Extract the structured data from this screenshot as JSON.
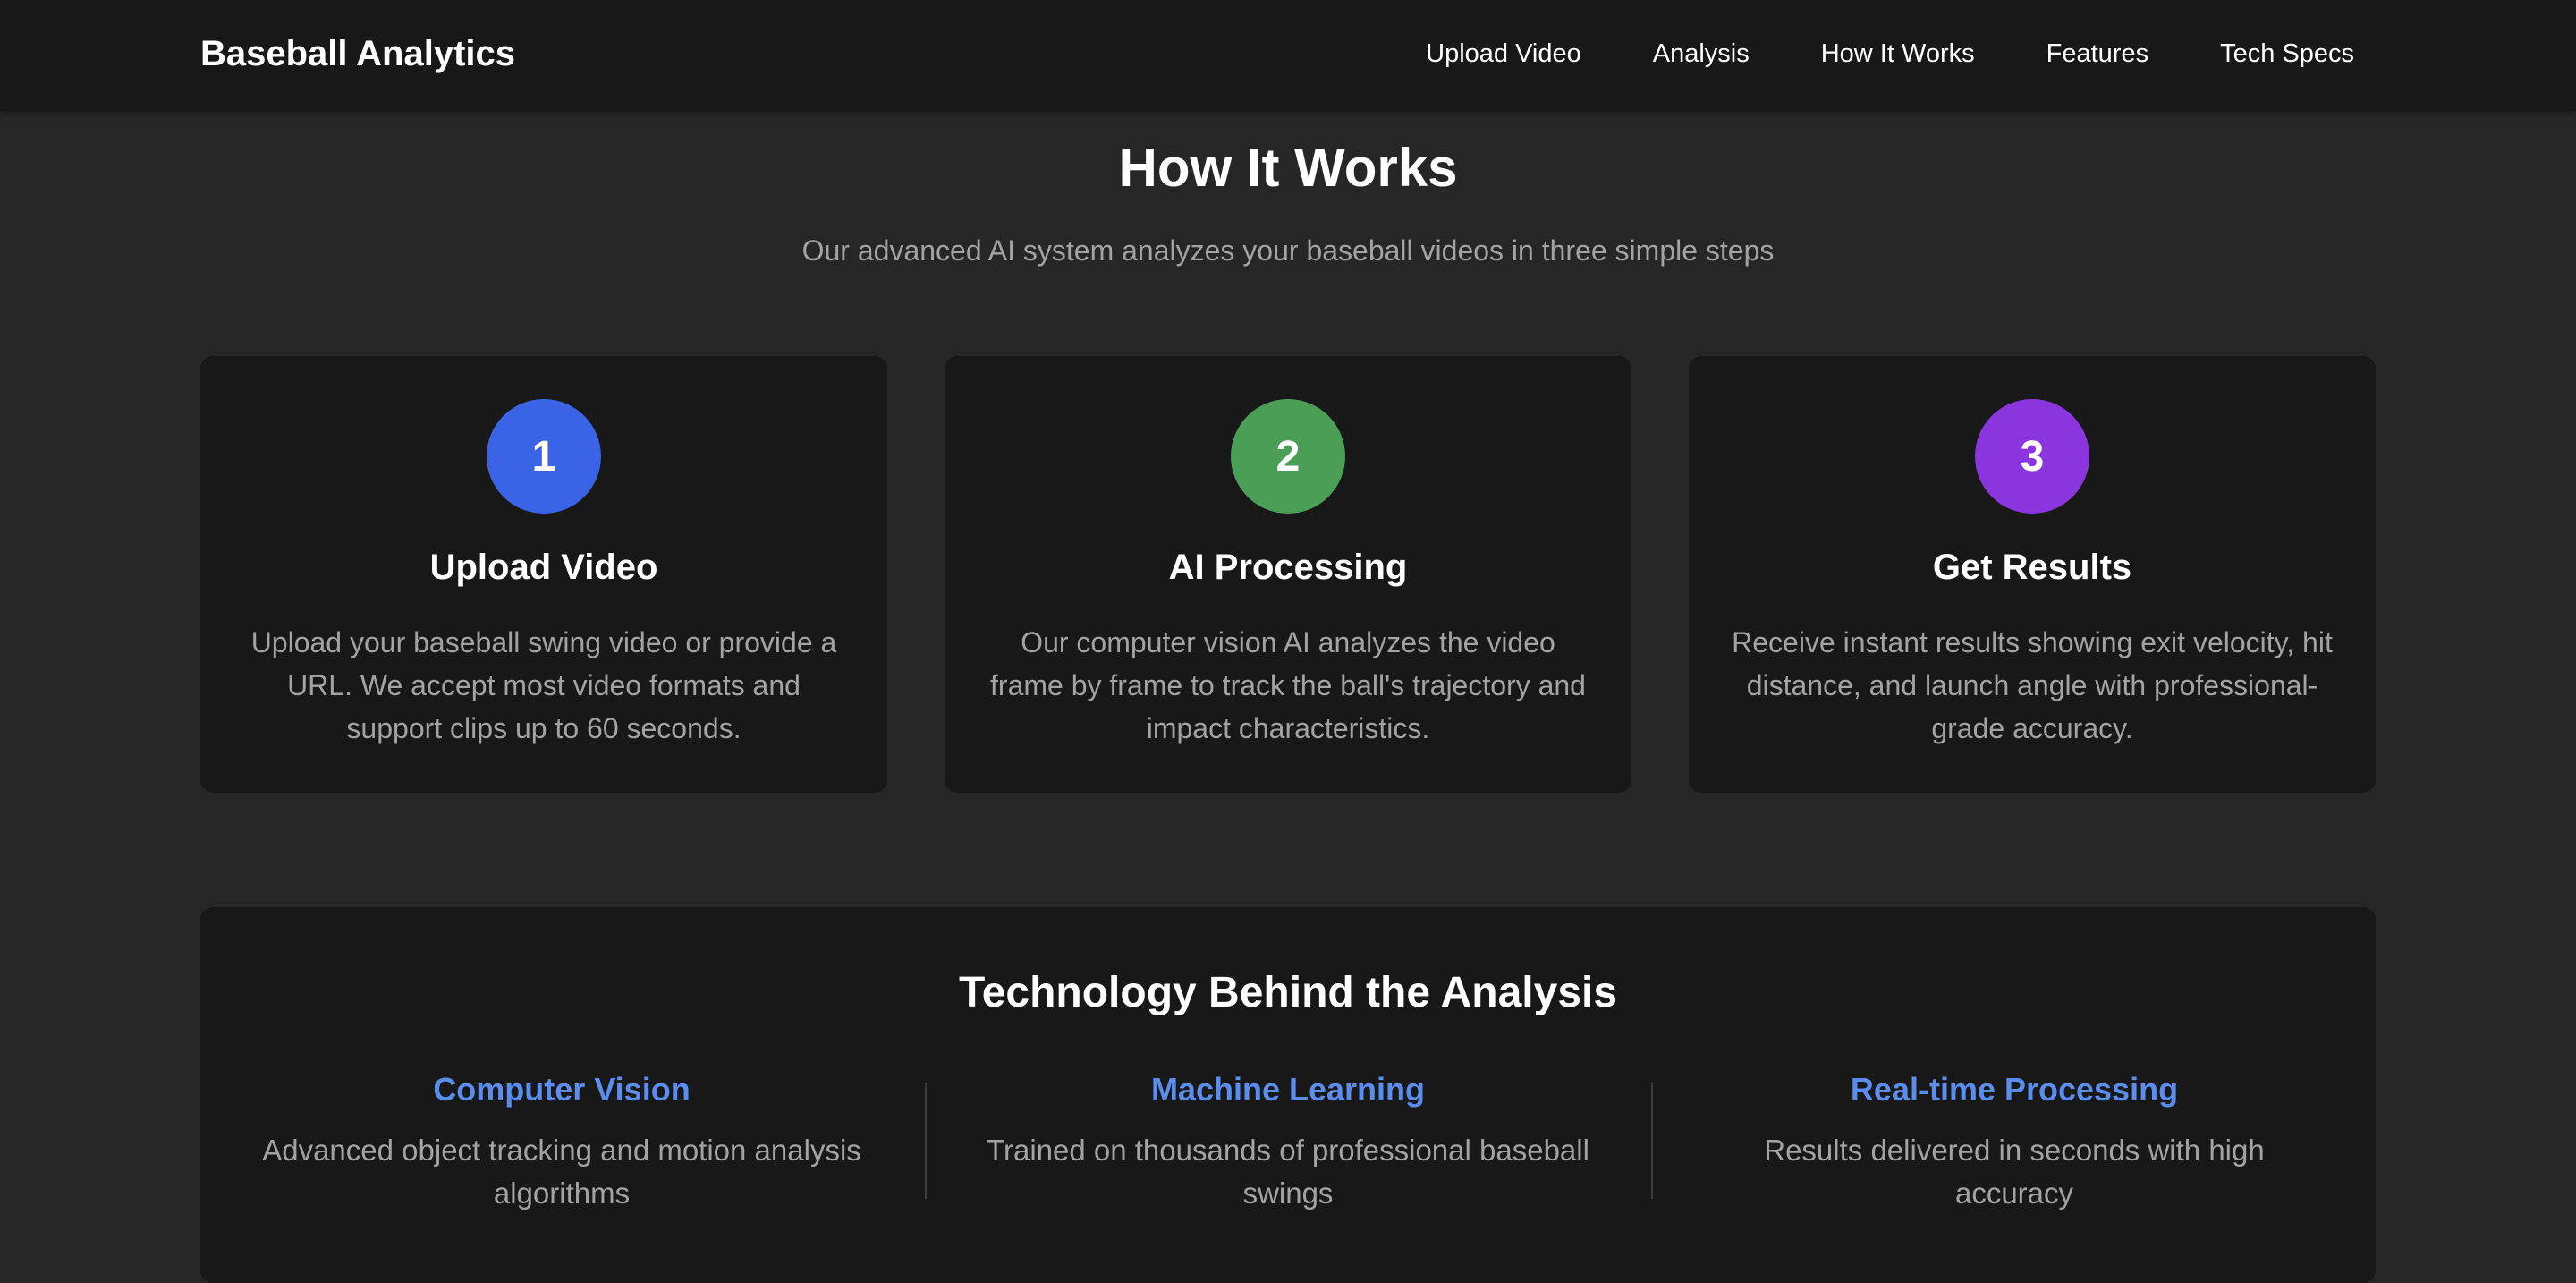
{
  "nav": {
    "brand": "Baseball Analytics",
    "links": [
      "Upload Video",
      "Analysis",
      "How It Works",
      "Features",
      "Tech Specs"
    ]
  },
  "how_it_works": {
    "title": "How It Works",
    "subtitle": "Our advanced AI system analyzes your baseball videos in three simple steps",
    "steps": [
      {
        "number": "1",
        "title": "Upload Video",
        "description": "Upload your baseball swing video or provide a URL. We accept most video formats and support clips up to 60 seconds.",
        "color": "#3b63e6"
      },
      {
        "number": "2",
        "title": "AI Processing",
        "description": "Our computer vision AI analyzes the video frame by frame to track the ball's trajectory and impact characteristics.",
        "color": "#4a9e55"
      },
      {
        "number": "3",
        "title": "Get Results",
        "description": "Receive instant results showing exit velocity, hit distance, and launch angle with professional-grade accuracy.",
        "color": "#8a35de"
      }
    ]
  },
  "technology": {
    "title": "Technology Behind the Analysis",
    "items": [
      {
        "title": "Computer Vision",
        "description": "Advanced object tracking and motion analysis algorithms"
      },
      {
        "title": "Machine Learning",
        "description": "Trained on thousands of professional baseball swings"
      },
      {
        "title": "Real-time Processing",
        "description": "Results delivered in seconds with high accuracy"
      }
    ],
    "accent_color": "#5b8def"
  }
}
